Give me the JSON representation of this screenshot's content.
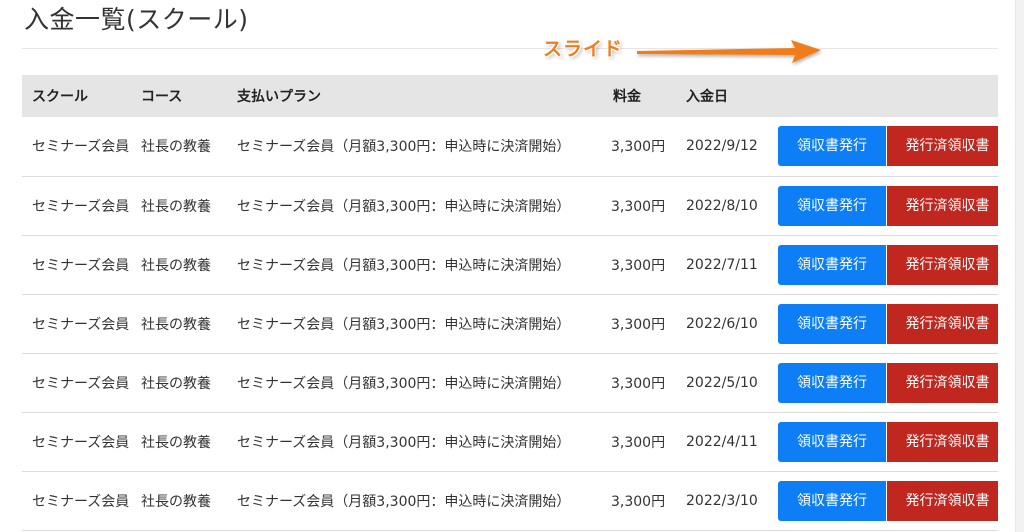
{
  "page": {
    "title": "入金一覧(スクール)"
  },
  "slide_hint": {
    "label": "スライド",
    "arrow_color": "#f07d1a"
  },
  "table": {
    "headers": {
      "school": "スクール",
      "course": "コース",
      "plan": "支払いプラン",
      "fee": "料金",
      "date": "入金日"
    },
    "rows": [
      {
        "school": "セミナーズ会員",
        "course": "社長の教養",
        "plan": "セミナーズ会員（月額3,300円：申込時に決済開始）",
        "fee": "3,300円",
        "date": "2022/9/12",
        "issue_label": "領収書発行",
        "reissue_label": "発行済領収書"
      },
      {
        "school": "セミナーズ会員",
        "course": "社長の教養",
        "plan": "セミナーズ会員（月額3,300円：申込時に決済開始）",
        "fee": "3,300円",
        "date": "2022/8/10",
        "issue_label": "領収書発行",
        "reissue_label": "発行済領収書"
      },
      {
        "school": "セミナーズ会員",
        "course": "社長の教養",
        "plan": "セミナーズ会員（月額3,300円：申込時に決済開始）",
        "fee": "3,300円",
        "date": "2022/7/11",
        "issue_label": "領収書発行",
        "reissue_label": "発行済領収書"
      },
      {
        "school": "セミナーズ会員",
        "course": "社長の教養",
        "plan": "セミナーズ会員（月額3,300円：申込時に決済開始）",
        "fee": "3,300円",
        "date": "2022/6/10",
        "issue_label": "領収書発行",
        "reissue_label": "発行済領収書"
      },
      {
        "school": "セミナーズ会員",
        "course": "社長の教養",
        "plan": "セミナーズ会員（月額3,300円：申込時に決済開始）",
        "fee": "3,300円",
        "date": "2022/5/10",
        "issue_label": "領収書発行",
        "reissue_label": "発行済領収書"
      },
      {
        "school": "セミナーズ会員",
        "course": "社長の教養",
        "plan": "セミナーズ会員（月額3,300円：申込時に決済開始）",
        "fee": "3,300円",
        "date": "2022/4/11",
        "issue_label": "領収書発行",
        "reissue_label": "発行済領収書"
      },
      {
        "school": "セミナーズ会員",
        "course": "社長の教養",
        "plan": "セミナーズ会員（月額3,300円：申込時に決済開始）",
        "fee": "3,300円",
        "date": "2022/3/10",
        "issue_label": "領収書発行",
        "reissue_label": "発行済領収書"
      }
    ]
  },
  "colors": {
    "issue_button": "#0d7ef5",
    "reissue_button": "#c0271f",
    "header_bg": "#e5e5e5"
  }
}
